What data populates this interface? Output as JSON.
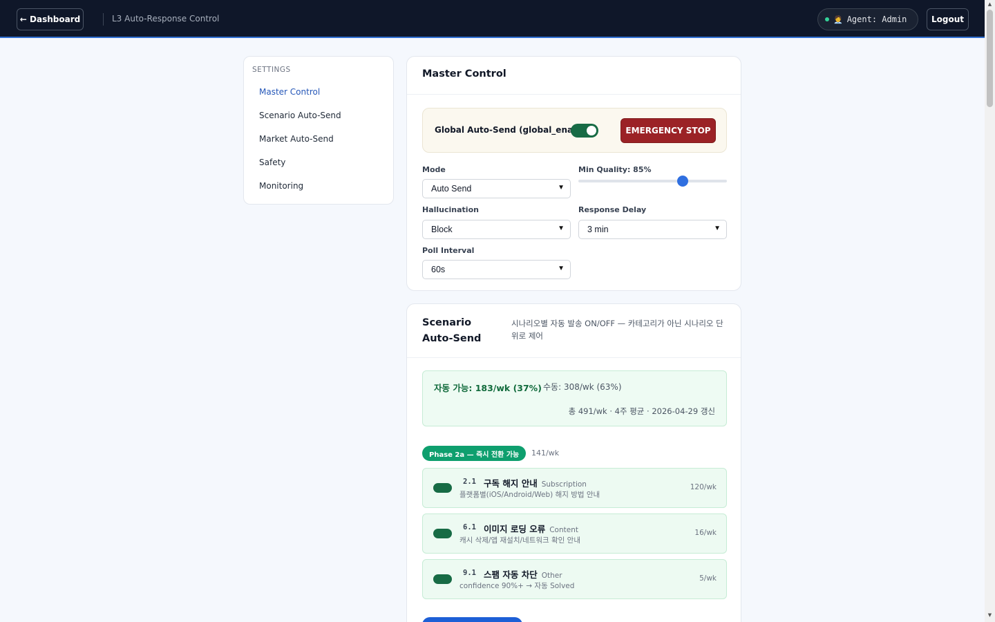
{
  "header": {
    "back_label": "← Dashboard",
    "title": "L3 Auto-Response Control",
    "agent_label": "Agent: Admin",
    "agent_emoji": "🧑‍💼",
    "logout_label": "Logout"
  },
  "sidebar": {
    "heading": "SETTINGS",
    "items": [
      {
        "label": "Master Control",
        "active": true
      },
      {
        "label": "Scenario Auto-Send",
        "active": false
      },
      {
        "label": "Market Auto-Send",
        "active": false
      },
      {
        "label": "Safety",
        "active": false
      },
      {
        "label": "Monitoring",
        "active": false
      }
    ]
  },
  "master": {
    "title": "Master Control",
    "global_label": "Global Auto-Send (global_enabled)",
    "global_enabled": true,
    "emergency_label": "EMERGENCY STOP",
    "mode_label": "Mode",
    "mode_value": "Auto Send",
    "quality_label": "Min Quality: 85%",
    "quality_value": 85,
    "hallucination_label": "Hallucination",
    "hallucination_value": "Block",
    "delay_label": "Response Delay",
    "delay_value": "3 min",
    "poll_label": "Poll Interval",
    "poll_value": "60s"
  },
  "scenario": {
    "title": "Scenario Auto-Send",
    "description": "시나리오별 자동 발송 ON/OFF — 카테고리가 아닌 시나리오 단위로 제어",
    "stat_auto": "자동 가능: 183/wk (37%)",
    "stat_manual": "수동: 308/wk (63%)",
    "stat_total": "총 491/wk · 4주 평균 · 2026-04-29 갱신",
    "phase_label": "Phase 2a — 즉시 전환 가능",
    "phase_rate": "141/wk",
    "rows": [
      {
        "code": "2.1",
        "name": "구독 해지 안내",
        "category": "Subscription",
        "desc": "플랫폼별(iOS/Android/Web) 해지 방법 안내",
        "rate": "120/wk",
        "enabled": true
      },
      {
        "code": "6.1",
        "name": "이미지 로딩 오류",
        "category": "Content",
        "desc": "캐시 삭제/앱 재설치/네트워크 확인 안내",
        "rate": "16/wk",
        "enabled": true
      },
      {
        "code": "9.1",
        "name": "스팸 자동 차단",
        "category": "Other",
        "desc": "confidence 90%+ → 자동 Solved",
        "rate": "5/wk",
        "enabled": true
      }
    ]
  },
  "colors": {
    "topbar": "#0f1729",
    "accent": "#2f6fe0",
    "toggle_on": "#176b45",
    "danger": "#9b2226",
    "phase_green": "#0e9f6e"
  }
}
